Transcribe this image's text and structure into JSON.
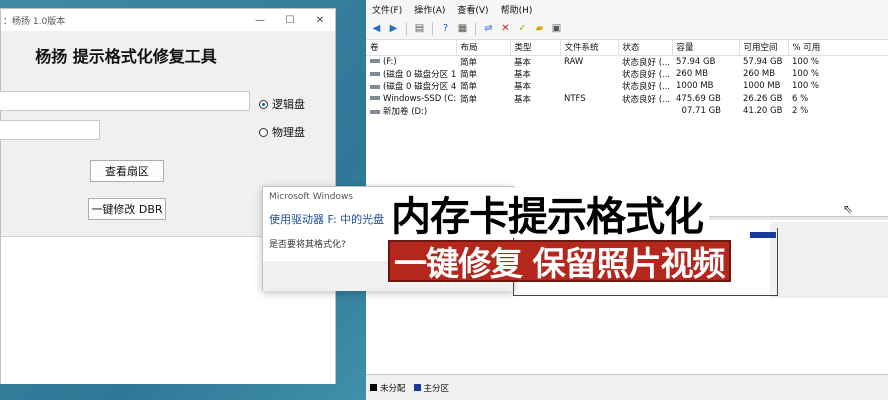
{
  "app": {
    "title": "杨扬 1.0版本",
    "title_prefix": "：",
    "heading": "杨扬 提示格式化修复工具",
    "radio_logical": "逻辑盘",
    "radio_physical": "物理盘",
    "btn_view_sector": "查看扇区",
    "btn_fix_dbr": "一键修改 DBR",
    "controls": {
      "minimize": "—",
      "maximize": "☐",
      "close": "✕"
    }
  },
  "dialog": {
    "title": "Microsoft Windows",
    "heading": "使用驱动器 F: 中的光盘",
    "question": "是否要将其格式化?"
  },
  "disk_mgmt": {
    "menu": [
      "文件(F)",
      "操作(A)",
      "查看(V)",
      "帮助(H)"
    ],
    "columns": [
      "卷",
      "布局",
      "类型",
      "文件系统",
      "状态",
      "容量",
      "可用空间",
      "% 可用"
    ],
    "rows": [
      [
        "(F:)",
        "简单",
        "基本",
        "RAW",
        "状态良好 (...",
        "57.94 GB",
        "57.94 GB",
        "100 %"
      ],
      [
        "(磁盘 0 磁盘分区 1)",
        "简单",
        "基本",
        "",
        "状态良好 (...",
        "260 MB",
        "260 MB",
        "100 %"
      ],
      [
        "(磁盘 0 磁盘分区 4)",
        "简单",
        "基本",
        "",
        "状态良好 (...",
        "1000 MB",
        "1000 MB",
        "100 %"
      ],
      [
        "Windows-SSD (C:)",
        "简单",
        "基本",
        "NTFS",
        "状态良好 (...",
        "475.69 GB",
        "26.26 GB",
        "6 %"
      ],
      [
        "新加卷 (D:)",
        "",
        "",
        "",
        "",
        "07.71 GB",
        "41.20 GB",
        "2 %"
      ]
    ],
    "legend": {
      "unallocated": "未分配",
      "primary": "主分区",
      "unallocated_color": "#000000",
      "primary_color": "#1a3aa0"
    }
  },
  "captions": {
    "line1": "内存卡提示格式化",
    "line2": "一键修复 保留照片视频"
  }
}
